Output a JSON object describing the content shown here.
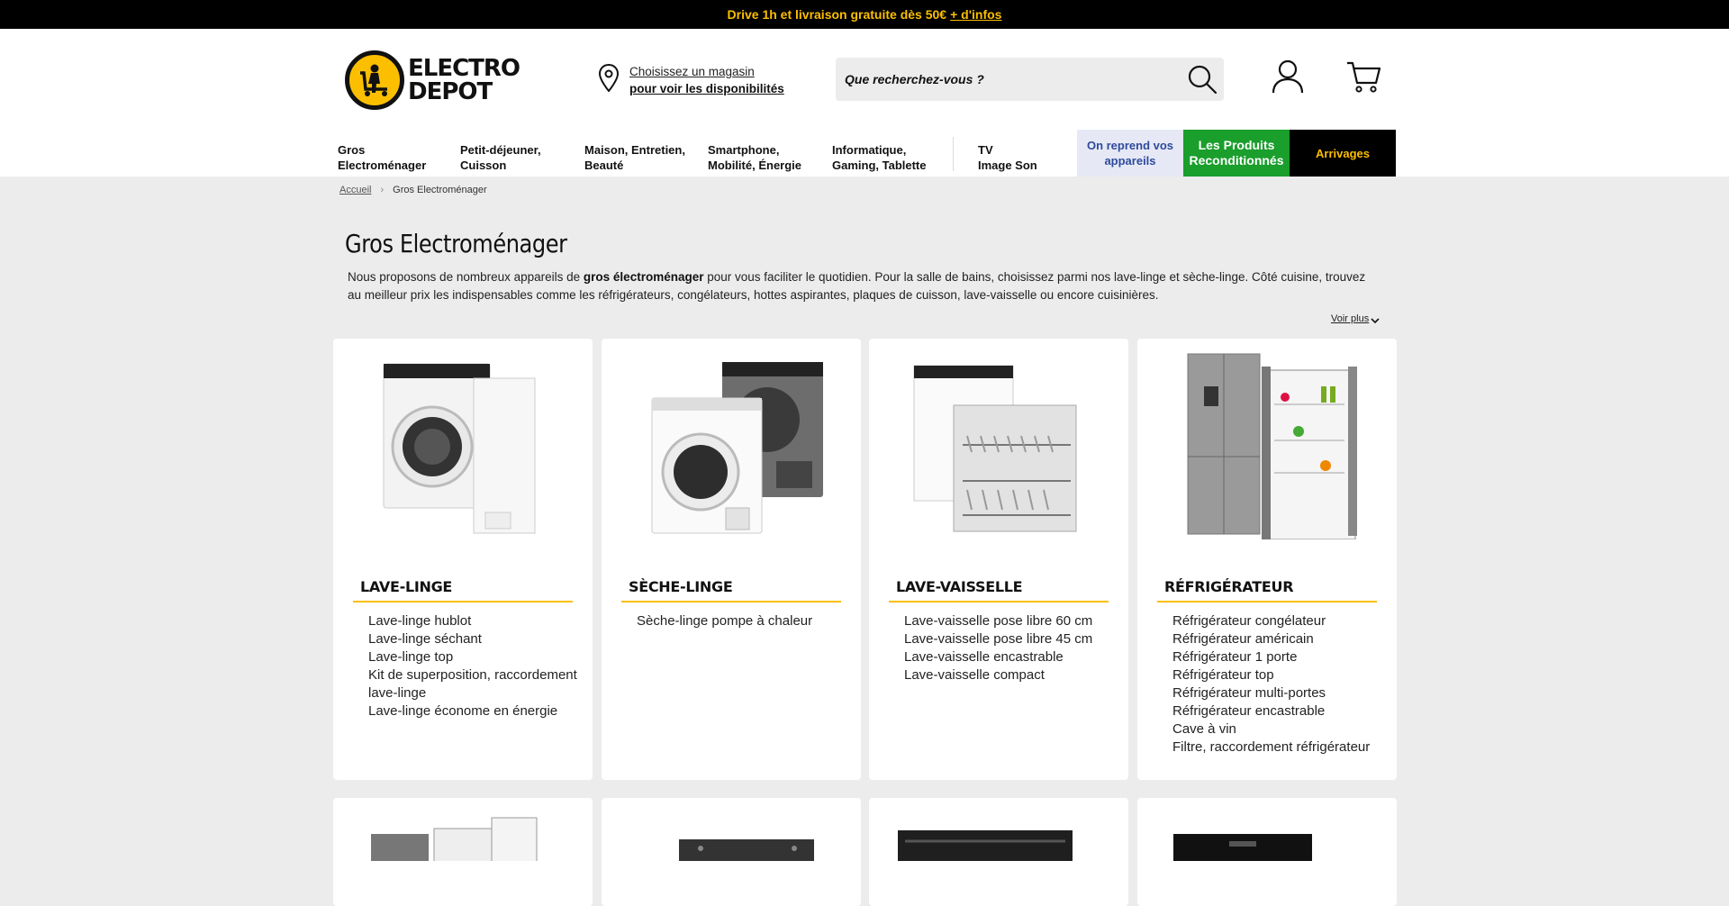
{
  "topbar": {
    "text": "Drive 1h et livraison gratuite dès 50€",
    "link": "+ d'infos"
  },
  "header": {
    "logo_line1": "ELECTRO",
    "logo_line2": "DEPOT",
    "store_line1": "Choisissez un magasin",
    "store_line2": "pour voir les disponibilités",
    "search_placeholder": "Que recherchez-vous ?"
  },
  "nav": {
    "items": [
      {
        "l1": "Gros",
        "l2": "Electroménager"
      },
      {
        "l1": "Petit-déjeuner,",
        "l2": "Cuisson"
      },
      {
        "l1": "Maison, Entretien,",
        "l2": "Beauté"
      },
      {
        "l1": "Smartphone,",
        "l2": "Mobilité, Énergie"
      },
      {
        "l1": "Informatique,",
        "l2": "Gaming, Tablette"
      },
      {
        "l1": "TV",
        "l2": "Image Son"
      }
    ],
    "reprend_l1": "On reprend vos",
    "reprend_l2": "appareils",
    "recond_l1": "Les Produits",
    "recond_l2": "Reconditionnés",
    "arrivages": "Arrivages"
  },
  "breadcrumb": {
    "home": "Accueil",
    "current": "Gros Electroménager"
  },
  "page": {
    "title": "Gros Electroménager",
    "desc_before": "Nous proposons de nombreux appareils de ",
    "desc_bold": "gros électroménager",
    "desc_after": " pour vous faciliter le quotidien. Pour la salle de bains, choisissez parmi nos lave-linge et sèche-linge. Côté cuisine, trouvez au meilleur prix les indispensables comme les réfrigérateurs, congélateurs, hottes aspirantes, plaques de cuisson, lave-vaisselle ou encore cuisinières.",
    "voir_plus": "Voir plus"
  },
  "categories": [
    {
      "title": "LAVE-LINGE",
      "links": [
        "Lave-linge hublot",
        "Lave-linge séchant",
        "Lave-linge top",
        "Kit de superposition, raccordement lave-linge",
        "Lave-linge économe en énergie"
      ]
    },
    {
      "title": "SÈCHE-LINGE",
      "links": [
        "Sèche-linge pompe à chaleur"
      ]
    },
    {
      "title": "LAVE-VAISSELLE",
      "links": [
        "Lave-vaisselle pose libre 60 cm",
        "Lave-vaisselle pose libre 45 cm",
        "Lave-vaisselle encastrable",
        "Lave-vaisselle compact"
      ]
    },
    {
      "title": "RÉFRIGÉRATEUR",
      "links": [
        "Réfrigérateur congélateur",
        "Réfrigérateur américain",
        "Réfrigérateur 1 porte",
        "Réfrigérateur top",
        "Réfrigérateur multi-portes",
        "Réfrigérateur encastrable",
        "Cave à vin",
        "Filtre, raccordement réfrigérateur"
      ]
    }
  ],
  "colors": {
    "brand_yellow": "#fcbf00",
    "recond_green": "#1a9e2c",
    "reprend_blue": "#2e4a9e"
  }
}
